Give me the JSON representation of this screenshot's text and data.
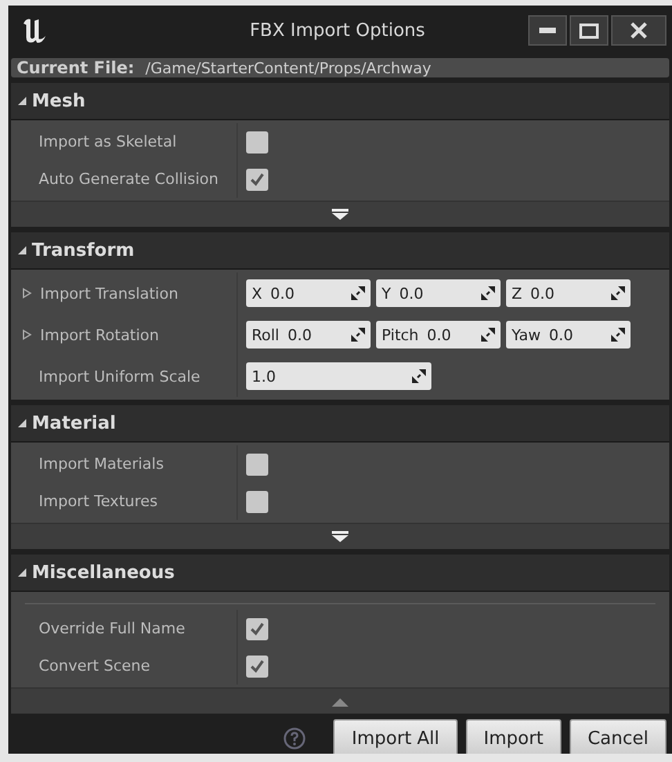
{
  "window": {
    "title": "FBX Import Options"
  },
  "current_file": {
    "label": "Current File:",
    "path": "/Game/StarterContent/Props/Archway"
  },
  "sections": [
    {
      "title": "Mesh",
      "expanded": true,
      "footer": {
        "kind": "more"
      },
      "rows": [
        {
          "kind": "checkbox",
          "label": "Import as Skeletal",
          "checked": false
        },
        {
          "kind": "checkbox",
          "label": "Auto Generate Collision",
          "checked": true
        }
      ]
    },
    {
      "title": "Transform",
      "expanded": true,
      "rows": [
        {
          "kind": "vector",
          "label": "Import Translation",
          "expandable": true,
          "fields": [
            {
              "prefix": "X",
              "value": "0.0"
            },
            {
              "prefix": "Y",
              "value": "0.0"
            },
            {
              "prefix": "Z",
              "value": "0.0"
            }
          ]
        },
        {
          "kind": "vector",
          "label": "Import Rotation",
          "expandable": true,
          "fields": [
            {
              "prefix": "Roll",
              "value": "0.0"
            },
            {
              "prefix": "Pitch",
              "value": "0.0"
            },
            {
              "prefix": "Yaw",
              "value": "0.0"
            }
          ]
        },
        {
          "kind": "scalar",
          "label": "Import Uniform Scale",
          "value": "1.0"
        }
      ]
    },
    {
      "title": "Material",
      "expanded": true,
      "footer": {
        "kind": "more"
      },
      "rows": [
        {
          "kind": "checkbox",
          "label": "Import Materials",
          "checked": false
        },
        {
          "kind": "checkbox",
          "label": "Import Textures",
          "checked": false
        }
      ]
    },
    {
      "title": "Miscellaneous",
      "expanded": true,
      "footer": {
        "kind": "less"
      },
      "rows": [
        {
          "kind": "checkbox",
          "label": "Override Full Name",
          "checked": true
        },
        {
          "kind": "checkbox",
          "label": "Convert Scene",
          "checked": true
        }
      ]
    }
  ],
  "buttons": [
    "Import All",
    "Import",
    "Cancel"
  ]
}
